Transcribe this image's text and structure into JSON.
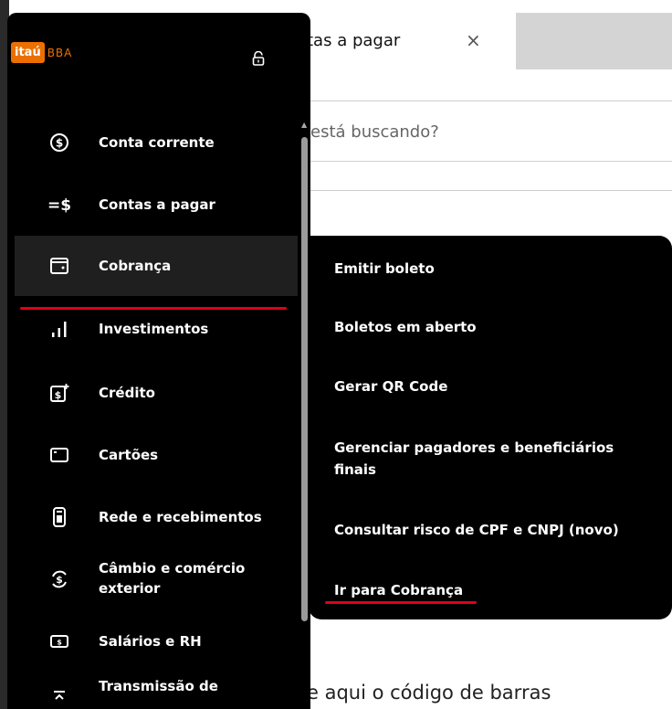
{
  "background": {
    "tab_label": "tas a pagar",
    "tab_close": "×",
    "search_placeholder": "está buscando?",
    "barcode_text": "e aqui o código de barras"
  },
  "brand": {
    "logo_text": "itaú",
    "logo_suffix": "BBA",
    "accent": "#ec7000",
    "highlight": "#e0001b"
  },
  "sidebar": {
    "items": [
      {
        "label": "Conta corrente",
        "icon": "dollar-circle-icon"
      },
      {
        "label": "Contas a pagar",
        "icon": "equals-dollar-icon"
      },
      {
        "label": "Cobrança",
        "icon": "wallet-icon"
      },
      {
        "label": "Investimentos",
        "icon": "bar-chart-icon"
      },
      {
        "label": "Crédito",
        "icon": "credit-dollar-icon"
      },
      {
        "label": "Cartões",
        "icon": "card-icon"
      },
      {
        "label": "Rede e recebimentos",
        "icon": "pos-terminal-icon"
      },
      {
        "label": "Câmbio e comércio exterior",
        "icon": "exchange-icon"
      },
      {
        "label": "Salários e RH",
        "icon": "money-bill-icon"
      },
      {
        "label": "Transmissão de",
        "icon": "transmit-icon"
      }
    ]
  },
  "submenu": {
    "items": [
      {
        "label": "Emitir boleto"
      },
      {
        "label": "Boletos em aberto"
      },
      {
        "label": "Gerar QR Code"
      },
      {
        "label": "Gerenciar pagadores e beneficiários finais"
      },
      {
        "label": "Consultar risco de CPF e CNPJ (novo)"
      },
      {
        "label": "Ir para Cobrança"
      }
    ]
  }
}
